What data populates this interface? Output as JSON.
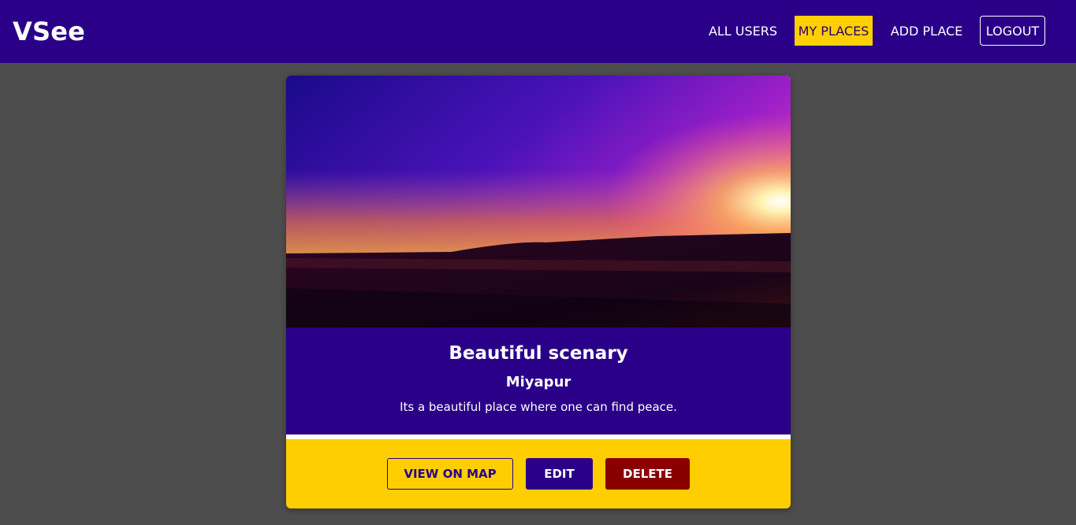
{
  "app": {
    "logo": "VSee"
  },
  "nav": {
    "all_users": "ALL USERS",
    "my_places": "MY PLACES",
    "add_place": "ADD PLACE",
    "logout": "LOGOUT",
    "active": "my_places"
  },
  "place": {
    "title": "Beautiful scenary",
    "address": "Miyapur",
    "description": "Its a beautiful place where one can find peace.",
    "image_alt": "Sunset over desert dunes"
  },
  "actions": {
    "view_on_map": "VIEW ON MAP",
    "edit": "EDIT",
    "delete": "DELETE"
  },
  "colors": {
    "primary": "#2a0088",
    "accent": "#ffce00",
    "danger": "#8a0000",
    "page_background": "#4d4d4d"
  }
}
